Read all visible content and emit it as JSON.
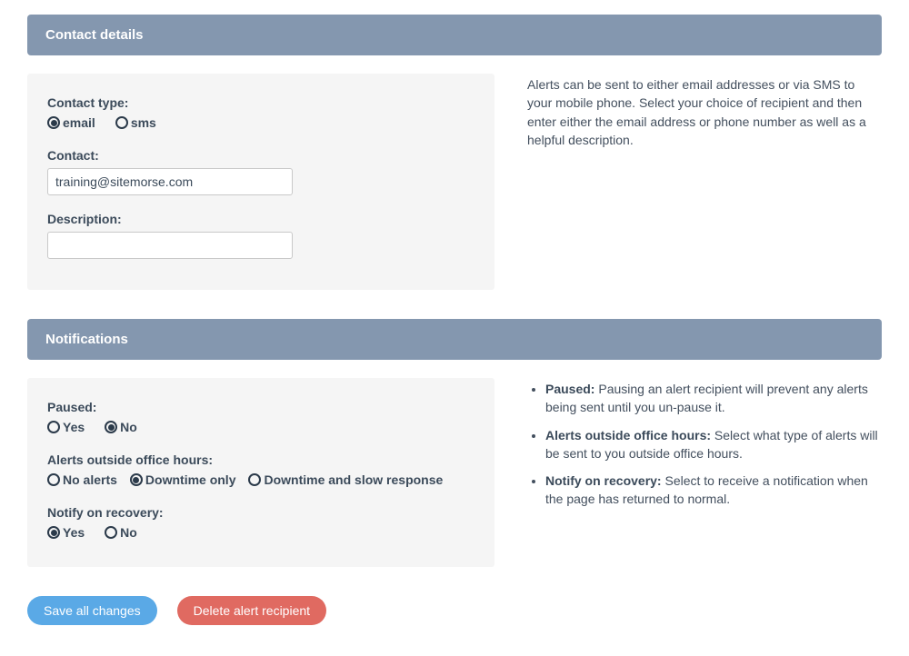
{
  "sections": {
    "contact": {
      "header": "Contact details",
      "contact_type_label": "Contact type:",
      "contact_type_options": {
        "email": "email",
        "sms": "sms"
      },
      "contact_label": "Contact:",
      "contact_value": "training@sitemorse.com",
      "description_label": "Description:",
      "description_value": "",
      "help_text": "Alerts can be sent to either email addresses or via SMS to your mobile phone. Select your choice of recipient and then enter either the email address or phone number as well as a helpful description."
    },
    "notifications": {
      "header": "Notifications",
      "paused_label": "Paused:",
      "yes": "Yes",
      "no": "No",
      "outside_label": "Alerts outside office hours:",
      "outside_options": {
        "none": "No alerts",
        "downtime": "Downtime only",
        "downtime_slow": "Downtime and slow response"
      },
      "recovery_label": "Notify on recovery:",
      "help": {
        "paused_title": "Paused:",
        "paused_text": " Pausing an alert recipient will prevent any alerts being sent until you un-pause it.",
        "outside_title": "Alerts outside office hours:",
        "outside_text": " Select what type of alerts will be sent to you outside office hours.",
        "recovery_title": "Notify on recovery:",
        "recovery_text": " Select to receive a notification when the page has returned to normal."
      }
    }
  },
  "actions": {
    "save": "Save all changes",
    "delete": "Delete alert recipient"
  }
}
